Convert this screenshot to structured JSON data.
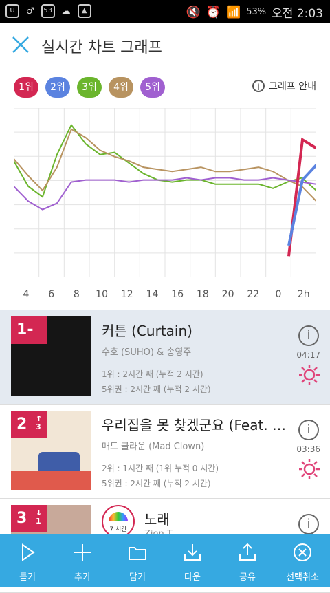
{
  "status_bar": {
    "badge": "53",
    "battery": "53%",
    "time": "오전 2:03"
  },
  "header": {
    "title": "실시간 차트 그래프"
  },
  "rank_buttons": [
    {
      "label": "1위",
      "color": "#d32752"
    },
    {
      "label": "2위",
      "color": "#5b83e0"
    },
    {
      "label": "3위",
      "color": "#6bb52d"
    },
    {
      "label": "4위",
      "color": "#b89360"
    },
    {
      "label": "5위",
      "color": "#a060d0"
    }
  ],
  "guide_label": "그래프 안내",
  "chart_data": {
    "type": "line",
    "x": [
      "3",
      "4",
      "5",
      "6",
      "7",
      "8",
      "9",
      "10",
      "11",
      "12",
      "13",
      "14",
      "15",
      "16",
      "17",
      "18",
      "19",
      "20",
      "21",
      "22",
      "23",
      "0",
      "1",
      "2"
    ],
    "x_tick_labels": [
      "4",
      "6",
      "8",
      "10",
      "12",
      "14",
      "16",
      "18",
      "20",
      "22",
      "0",
      "2h"
    ],
    "grid": true,
    "series": [
      {
        "color": "#6bb52d",
        "values": [
          5.5,
          4.3,
          3.8,
          5.8,
          7.2,
          6.3,
          5.8,
          5.9,
          5.4,
          4.9,
          4.6,
          4.5,
          4.6,
          4.6,
          4.4,
          4.4,
          4.4,
          4.4,
          4.2,
          4.5,
          4.7,
          4.1
        ]
      },
      {
        "color": "#b89360",
        "values": [
          5.6,
          4.8,
          4.1,
          5.2,
          7.0,
          6.6,
          6.0,
          5.7,
          5.5,
          5.2,
          5.1,
          5.0,
          5.1,
          5.2,
          5.0,
          5.0,
          5.1,
          5.2,
          5.0,
          4.6,
          4.3,
          3.6
        ]
      },
      {
        "color": "#a060d0",
        "values": [
          4.3,
          3.6,
          3.2,
          3.5,
          4.5,
          4.6,
          4.6,
          4.6,
          4.5,
          4.6,
          4.6,
          4.6,
          4.7,
          4.6,
          4.7,
          4.7,
          4.6,
          4.6,
          4.7,
          4.6,
          4.5,
          4.4
        ]
      },
      {
        "color": "#d32752",
        "values": [
          1.0,
          6.5,
          6.1
        ]
      },
      {
        "color": "#5b83e0",
        "values": [
          1.5,
          4.6,
          5.3
        ]
      }
    ]
  },
  "songs": [
    {
      "rank": "1",
      "change": "-",
      "title": "커튼 (Curtain)",
      "artist": "수호 (SUHO) & 송영주",
      "stat1": "1위 : 2시간 째 (누적 2 시간)",
      "stat2": "5위권 : 2시간 째 (누적 2 시간)",
      "duration": "04:17"
    },
    {
      "rank": "2",
      "change": "↑ 3",
      "title": "우리집을 못 찾겠군요 (Feat. 볼빨간…",
      "artist": "매드 클라운 (Mad Clown)",
      "stat1": "2위 : 1시간 째 (1위 누적 0 시간)",
      "stat2": "5위권 : 2시간 째 (누적 2 시간)",
      "duration": "03:36"
    },
    {
      "rank": "3",
      "change": "↓ 1",
      "title": "노래",
      "artist": "Zion.T",
      "badge": "7 시간"
    }
  ],
  "bottom_bar": [
    {
      "label": "듣기",
      "icon": "play-icon"
    },
    {
      "label": "추가",
      "icon": "plus-icon"
    },
    {
      "label": "담기",
      "icon": "folder-icon"
    },
    {
      "label": "다운",
      "icon": "download-icon"
    },
    {
      "label": "공유",
      "icon": "share-icon"
    },
    {
      "label": "선택취소",
      "icon": "cancel-icon"
    }
  ]
}
